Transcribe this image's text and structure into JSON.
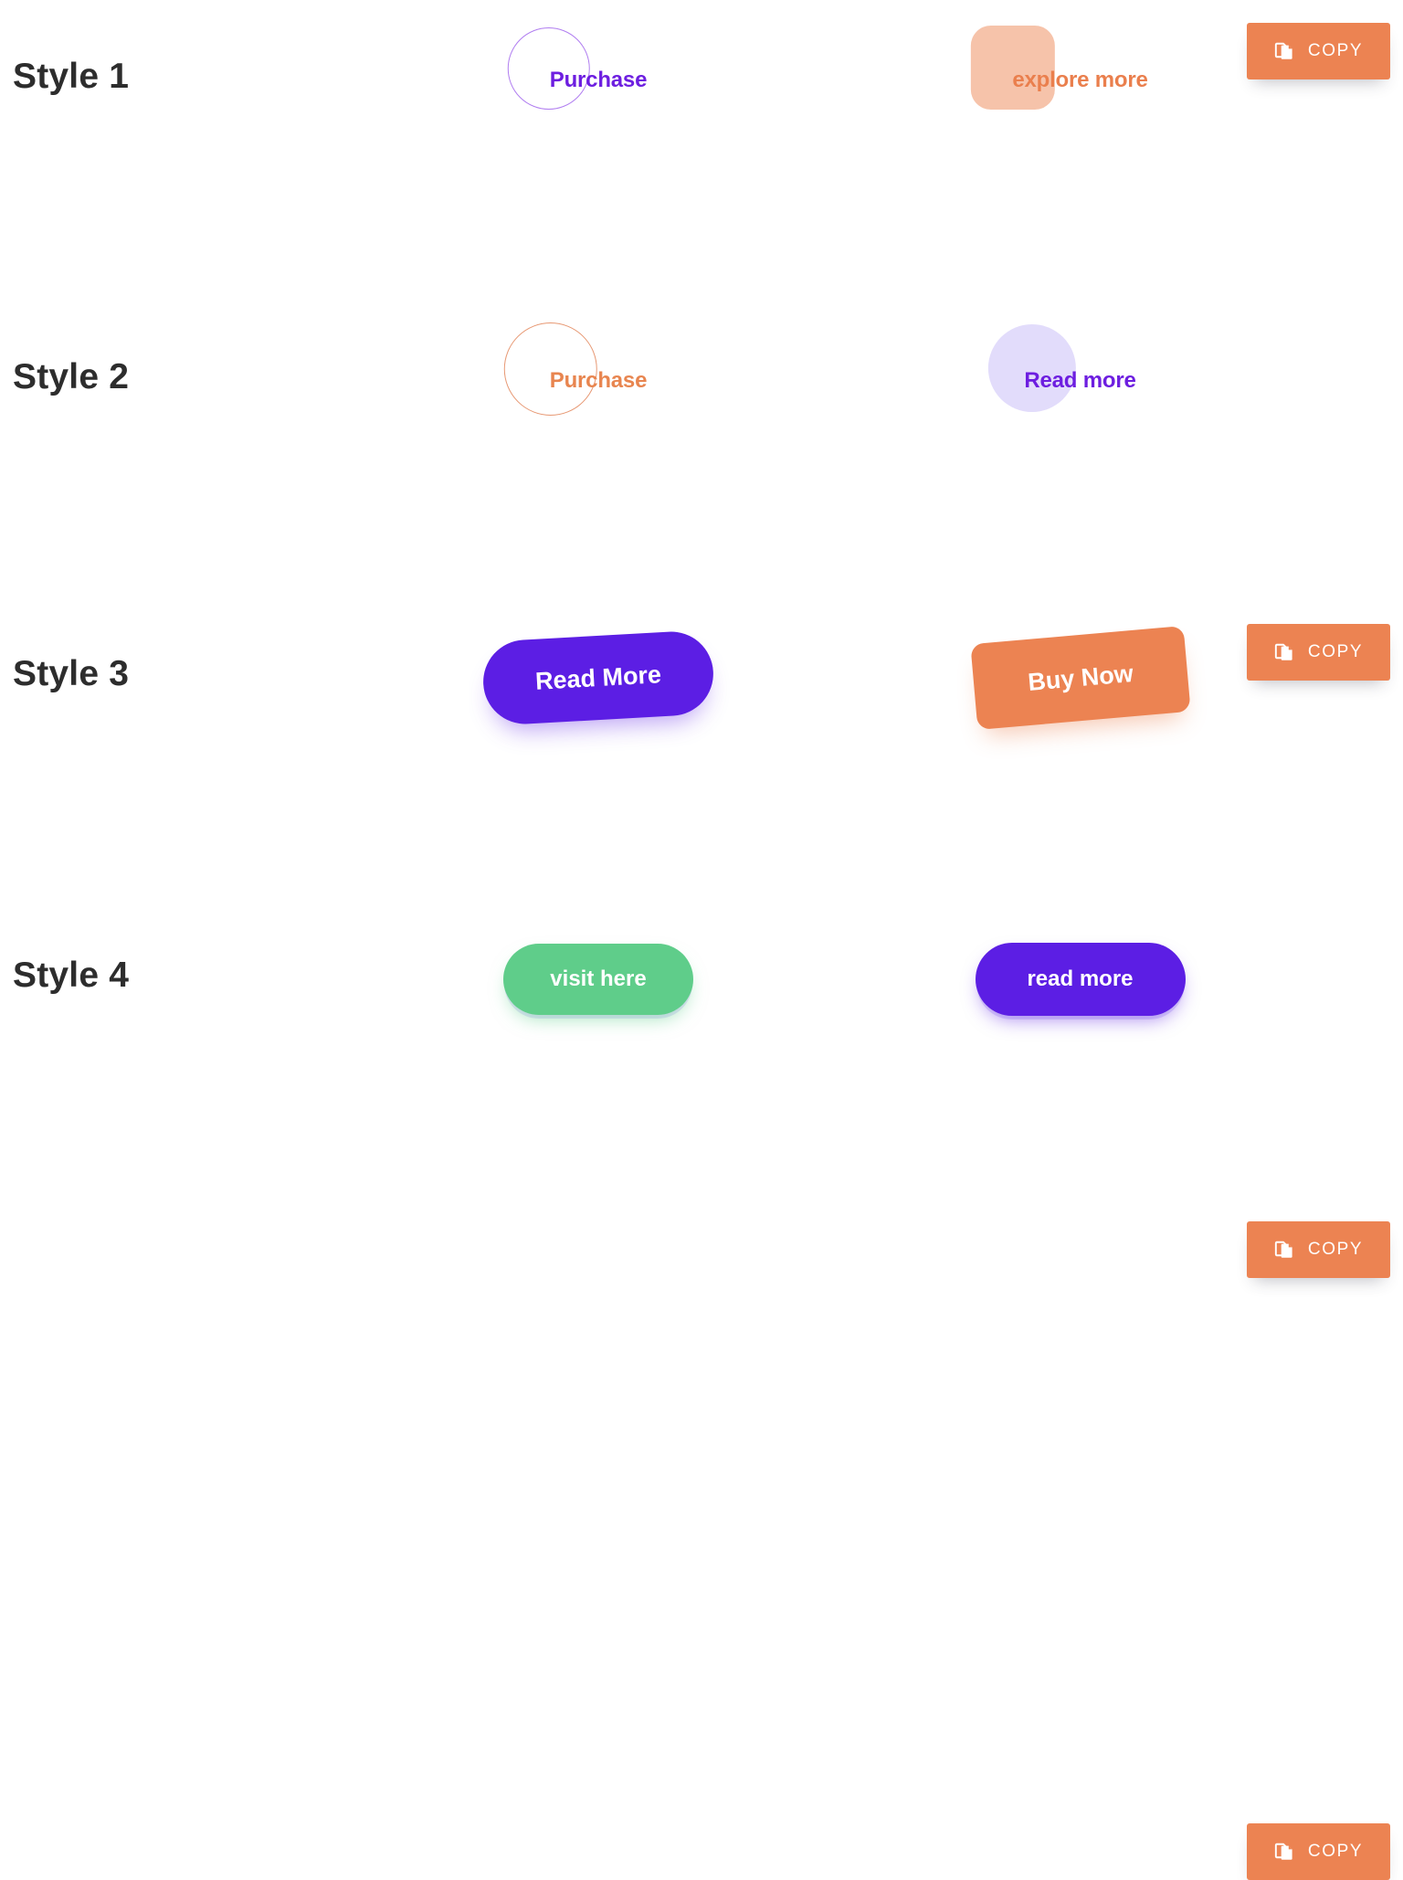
{
  "page": {
    "background": "#ffffff",
    "accent_orange": "#ec8352",
    "accent_purple": "#5c1ee4",
    "accent_green": "#5fcd8a",
    "accent_peach": "#f6c3aa",
    "accent_lavender": "#e2dcfb",
    "label_color": "#2d2d2d"
  },
  "rows": [
    {
      "label": "Style 1",
      "preview_a": {
        "text": "Purchase",
        "shape": "circle-outline",
        "color": "#6d1ee0"
      },
      "preview_b": {
        "text": "explore more",
        "shape": "rounded-square-fill",
        "color": "#ea7f4d"
      },
      "copy": {
        "label": "COPY",
        "icon": "copy-icon"
      }
    },
    {
      "label": "Style 2",
      "preview_a": {
        "text": "Purchase",
        "shape": "circle-outline",
        "color": "#e8854f"
      },
      "preview_b": {
        "text": "Read more",
        "shape": "circle-fill",
        "color": "#6d1ee0"
      },
      "copy": {
        "label": "COPY",
        "icon": "copy-icon"
      }
    },
    {
      "label": "Style 3",
      "preview_a": {
        "text": "Read More",
        "shape": "pill-tilted",
        "color": "#5c1ee4"
      },
      "preview_b": {
        "text": "Buy Now",
        "shape": "rect-tilted",
        "color": "#ec8352"
      },
      "copy": {
        "label": "COPY",
        "icon": "copy-icon"
      }
    },
    {
      "label": "Style 4",
      "preview_a": {
        "text": "visit here",
        "shape": "pill",
        "color": "#5fcd8a"
      },
      "preview_b": {
        "text": "read more",
        "shape": "pill",
        "color": "#5c1ee4"
      },
      "copy": {
        "label": "COPY",
        "icon": "copy-icon"
      }
    }
  ]
}
